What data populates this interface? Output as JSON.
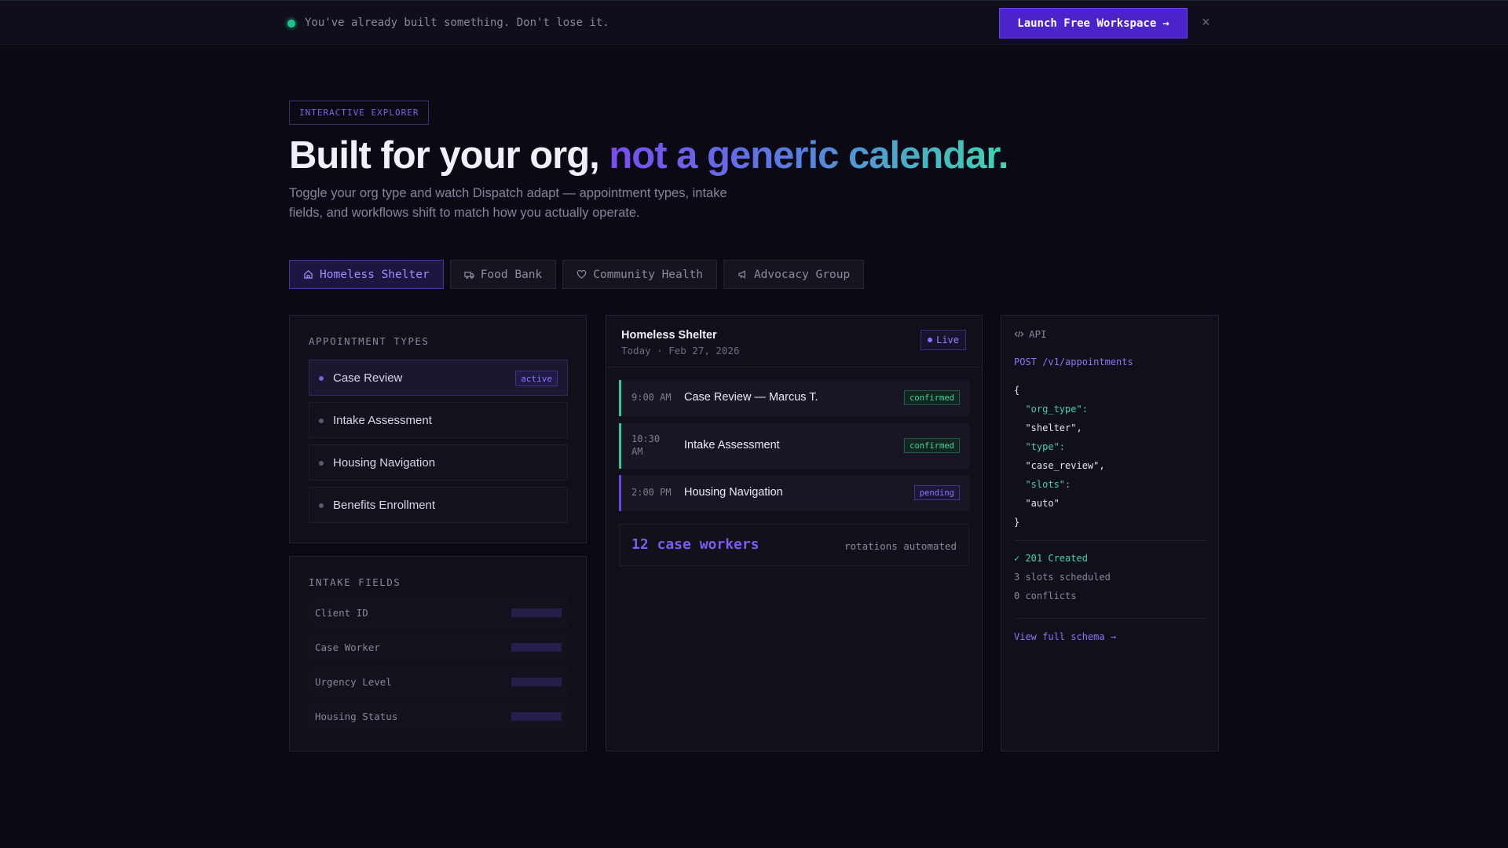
{
  "banner": {
    "message": "You've already built something. Don't lose it.",
    "cta_label": "Launch Free Workspace",
    "cta_arrow": "→",
    "close_glyph": "×"
  },
  "hero": {
    "eyebrow": "INTERACTIVE EXPLORER",
    "headline_plain": "Built for your org, ",
    "headline_accent": "not a generic calendar.",
    "subtitle": "Toggle your org type and watch Dispatch adapt — appointment types, intake fields, and workflows shift to match how you actually operate."
  },
  "tabs": [
    {
      "label": "Homeless Shelter",
      "icon": "home-icon",
      "active": true
    },
    {
      "label": "Food Bank",
      "icon": "truck-icon",
      "active": false
    },
    {
      "label": "Community Health",
      "icon": "heart-icon",
      "active": false
    },
    {
      "label": "Advocacy Group",
      "icon": "megaphone-icon",
      "active": false
    }
  ],
  "appointment_types": {
    "title": "APPOINTMENT TYPES",
    "items": [
      {
        "label": "Case Review",
        "badge": "active"
      },
      {
        "label": "Intake Assessment"
      },
      {
        "label": "Housing Navigation"
      },
      {
        "label": "Benefits Enrollment"
      }
    ]
  },
  "intake_fields": {
    "title": "INTAKE FIELDS",
    "items": [
      "Client ID",
      "Case Worker",
      "Urgency Level",
      "Housing Status"
    ]
  },
  "schedule": {
    "title": "Homeless Shelter",
    "date": "Today · Feb 27, 2026",
    "live_label": "Live",
    "appointments": [
      {
        "time": "9:00 AM",
        "name": "Case Review — Marcus T.",
        "status": "confirmed"
      },
      {
        "time": "10:30 AM",
        "name": "Intake Assessment",
        "status": "confirmed"
      },
      {
        "time": "2:00 PM",
        "name": "Housing Navigation",
        "status": "pending"
      }
    ],
    "stat_value": "12 case workers",
    "stat_note": "rotations automated"
  },
  "api": {
    "label": "API",
    "endpoint": "POST /v1/appointments",
    "open_brace": "{",
    "close_brace": "}",
    "keys": {
      "org_type": "\"org_type\":",
      "org_type_val": "\"shelter\",",
      "type": "\"type\":",
      "type_val": "\"case_review\",",
      "slots": "\"slots\":",
      "slots_val": "\"auto\""
    },
    "response_status": "✓ 201 Created",
    "response_lines": [
      "3 slots scheduled",
      "0 conflicts"
    ],
    "schema_link": "View full schema →"
  },
  "colors": {
    "background": "#0b0a14",
    "accent": "#7b5cf0",
    "success": "#44d3a6",
    "cta": "#4b24c9"
  }
}
